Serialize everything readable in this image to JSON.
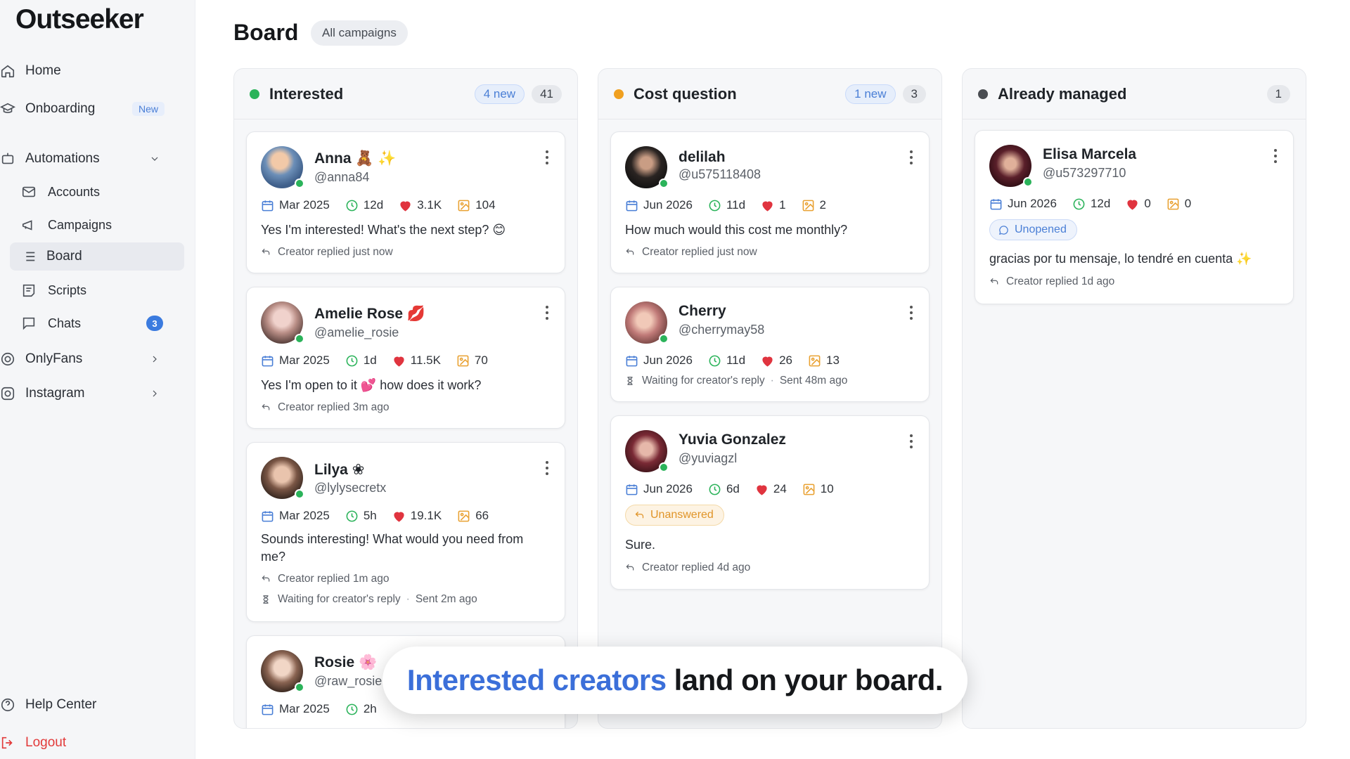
{
  "app": {
    "logo": "Outseeker"
  },
  "sidebar": {
    "home": "Home",
    "onboarding": "Onboarding",
    "onboarding_badge": "New",
    "automations": "Automations",
    "accounts": "Accounts",
    "campaigns": "Campaigns",
    "board": "Board",
    "scripts": "Scripts",
    "chats": "Chats",
    "chats_badge": "3",
    "onlyfans": "OnlyFans",
    "instagram": "Instagram",
    "help": "Help Center",
    "logout": "Logout"
  },
  "header": {
    "title": "Board",
    "filter": "All campaigns"
  },
  "columns": [
    {
      "title": "Interested",
      "dot_color": "#2bb35a",
      "new": "4 new",
      "count": "41",
      "cards": [
        {
          "name": "Anna 🧸 ✨",
          "handle": "@anna84",
          "date": "Mar 2025",
          "age": "12d",
          "likes": "3.1K",
          "media": "104",
          "message": "Yes I'm interested! What's the next step? 😊",
          "reply": "Creator replied just now"
        },
        {
          "name": "Amelie Rose 💋",
          "handle": "@amelie_rosie",
          "date": "Mar 2025",
          "age": "1d",
          "likes": "11.5K",
          "media": "70",
          "message": "Yes I'm open to it 💕 how does it work?",
          "reply": "Creator replied 3m ago"
        },
        {
          "name": "Lilya ❀",
          "handle": "@lylysecretx",
          "date": "Mar 2025",
          "age": "5h",
          "likes": "19.1K",
          "media": "66",
          "message": "Sounds interesting! What would you need from me?",
          "reply": "Creator replied 1m ago",
          "waiting": "Waiting for creator's reply",
          "sent": "Sent 2m ago"
        },
        {
          "name": "Rosie 🌸",
          "handle": "@raw_rosie",
          "date": "Mar 2025",
          "age": "2h"
        }
      ]
    },
    {
      "title": "Cost question",
      "dot_color": "#f0a020",
      "new": "1 new",
      "count": "3",
      "cards": [
        {
          "name": "delilah",
          "handle": "@u575118408",
          "date": "Jun 2026",
          "age": "11d",
          "likes": "1",
          "media": "2",
          "message": "How much would this cost me monthly?",
          "reply": "Creator replied just now"
        },
        {
          "name": "Cherry",
          "handle": "@cherrymay58",
          "date": "Jun 2026",
          "age": "11d",
          "likes": "26",
          "media": "13",
          "waiting": "Waiting for creator's reply",
          "sent": "Sent 48m ago"
        },
        {
          "name": "Yuvia Gonzalez",
          "handle": "@yuviagzl",
          "date": "Jun 2026",
          "age": "6d",
          "likes": "24",
          "media": "10",
          "status": "Unanswered",
          "message": "Sure.",
          "reply": "Creator replied 4d ago"
        }
      ]
    },
    {
      "title": "Already managed",
      "dot_color": "#4a4d52",
      "count": "1",
      "cards": [
        {
          "name": "Elisa Marcela",
          "handle": "@u573297710",
          "date": "Jun 2026",
          "age": "12d",
          "likes": "0",
          "media": "0",
          "status": "Unopened",
          "message": "gracias por tu mensaje, lo tendré en cuenta ✨",
          "reply": "Creator replied 1d ago"
        }
      ]
    }
  ],
  "caption": {
    "highlight": "Interested creators",
    "rest": "land on your board."
  }
}
